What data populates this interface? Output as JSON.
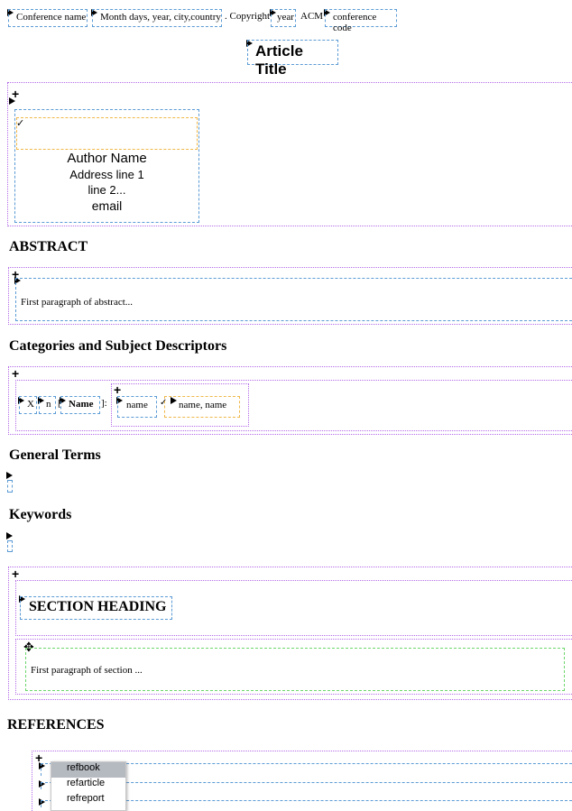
{
  "conference": {
    "name": "Conference name",
    "date_place": "Month days, year, city,country",
    "copyright_prefix": ". Copyright",
    "year": "year",
    "acm": "ACM",
    "code": "conference code"
  },
  "title": "Article Title",
  "author": {
    "name": "Author Name",
    "address1": "Address line 1",
    "address2": "line 2...",
    "email": "email"
  },
  "abstract": {
    "heading": "ABSTRACT",
    "paragraph": "First paragraph of abstract..."
  },
  "categories": {
    "heading": "Categories and Subject Descriptors",
    "x": "X",
    "n": "n",
    "bracket_open": "[",
    "name_bold": "Name",
    "bracket_close": "]:",
    "name": "name",
    "names": "name, name"
  },
  "general_terms": {
    "heading": "General Terms"
  },
  "keywords": {
    "heading": "Keywords"
  },
  "section": {
    "heading": "SECTION HEADING",
    "paragraph": "First paragraph of section ..."
  },
  "references": {
    "heading": "REFERENCES",
    "menu": [
      "refbook",
      "refarticle",
      "refreport"
    ],
    "selected": "refbook"
  }
}
